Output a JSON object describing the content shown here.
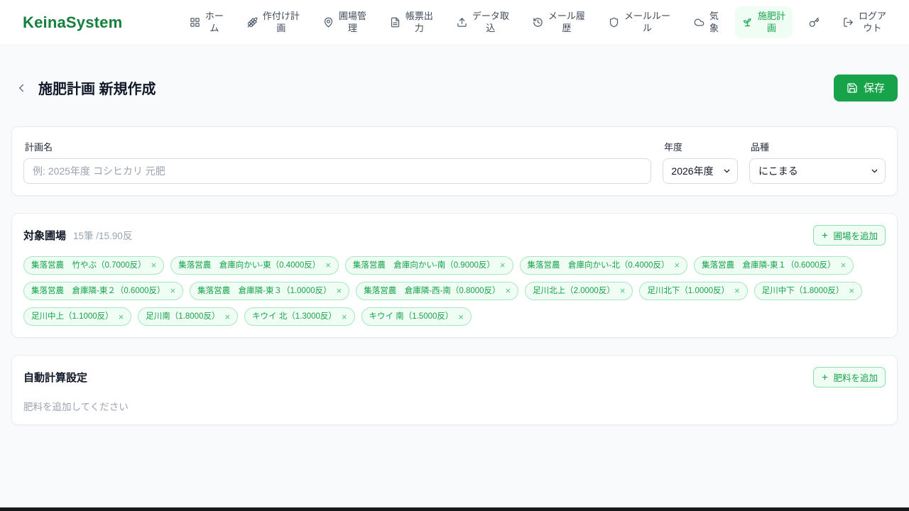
{
  "brand": "KeinaSystem",
  "colors": {
    "accent_green": "#16a34a",
    "logo_green": "#15803d",
    "accent_bg_green": "#f0fdf4",
    "tag_border_green": "#a5e8bf"
  },
  "nav": {
    "items": [
      {
        "id": "home",
        "icon": "grid-icon",
        "label": "ホー\nム",
        "active": false
      },
      {
        "id": "planting-plan",
        "icon": "wheat-icon",
        "label": "作付け計\n画",
        "active": false
      },
      {
        "id": "field-management",
        "icon": "map-pin-icon",
        "label": "圃場管\n理",
        "active": false
      },
      {
        "id": "report-output",
        "icon": "document-icon",
        "label": "帳票出\n力",
        "active": false
      },
      {
        "id": "data-import",
        "icon": "upload-icon",
        "label": "データ取\n込",
        "active": false
      },
      {
        "id": "mail-history",
        "icon": "history-icon",
        "label": "メール履\n歴",
        "active": false
      },
      {
        "id": "mail-rules",
        "icon": "shield-icon",
        "label": "メールルー\nル",
        "active": false
      },
      {
        "id": "weather",
        "icon": "cloud-icon",
        "label": "気\n象",
        "active": false
      },
      {
        "id": "fertilization-plan",
        "icon": "sprout-icon",
        "label": "施肥計\n画",
        "active": true
      },
      {
        "id": "key",
        "icon": "key-icon",
        "label": "",
        "active": false
      },
      {
        "id": "logout",
        "icon": "logout-icon",
        "label": "ログア\nウト",
        "active": false
      }
    ]
  },
  "page": {
    "title": "施肥計画 新規作成",
    "save_label": "保存"
  },
  "form": {
    "plan_name": {
      "label": "計画名",
      "value": "",
      "placeholder": "例: 2025年度 コシヒカリ 元肥"
    },
    "year": {
      "label": "年度",
      "value": "2026年度"
    },
    "variety": {
      "label": "品種",
      "value": "にこまる"
    }
  },
  "fields_section": {
    "title": "対象圃場",
    "summary": "15筆 /15.90反",
    "add_label": "圃場を追加",
    "tags": [
      {
        "label": "集落営農　竹やぶ（0.7000反）"
      },
      {
        "label": "集落営農　倉庫向かい-東（0.4000反）"
      },
      {
        "label": "集落営農　倉庫向かい-南（0.9000反）"
      },
      {
        "label": "集落営農　倉庫向かい-北（0.4000反）"
      },
      {
        "label": "集落営農　倉庫隣-東１（0.6000反）"
      },
      {
        "label": "集落営農　倉庫隣-東２（0.6000反）"
      },
      {
        "label": "集落営農　倉庫隣-東３（1.0000反）"
      },
      {
        "label": "集落営農　倉庫隣-西-南（0.8000反）"
      },
      {
        "label": "足川北上（2.0000反）"
      },
      {
        "label": "足川北下（1.0000反）"
      },
      {
        "label": "足川中下（1.8000反）"
      },
      {
        "label": "足川中上（1.1000反）"
      },
      {
        "label": "足川南（1.8000反）"
      },
      {
        "label": "キウイ 北（1.3000反）"
      },
      {
        "label": "キウイ 南（1.5000反）"
      }
    ]
  },
  "fertilizer_section": {
    "title": "自動計算設定",
    "add_label": "肥料を追加",
    "empty_text": "肥料を追加してください"
  }
}
